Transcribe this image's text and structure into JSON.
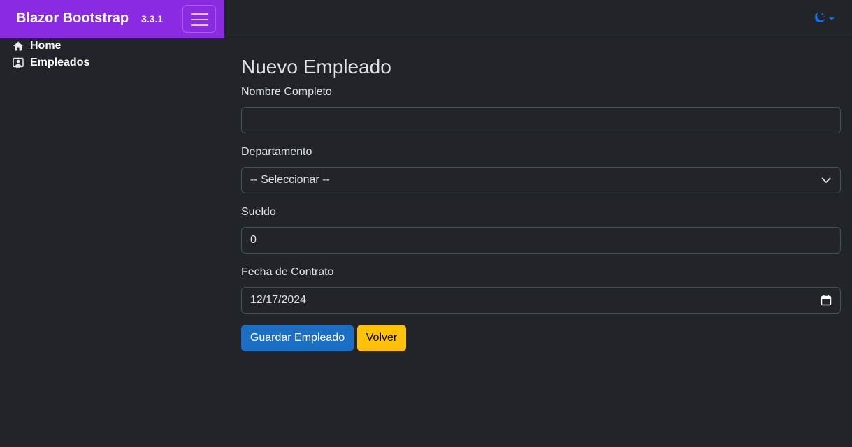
{
  "brand": {
    "name": "Blazor Bootstrap",
    "version": "3.3.1",
    "color": "#8a2be2"
  },
  "header": {
    "menu_toggle_icon": "hamburger-icon",
    "theme_icon": "moon-stars-icon",
    "theme_color": "#0d6efd"
  },
  "sidebar": {
    "items": [
      {
        "label": "Home",
        "icon": "house-icon"
      },
      {
        "label": "Empleados",
        "icon": "person-badge-icon"
      }
    ]
  },
  "form": {
    "title": "Nuevo Empleado",
    "fields": {
      "nombre": {
        "label": "Nombre Completo",
        "value": ""
      },
      "departamento": {
        "label": "Departamento",
        "value": "-- Seleccionar --"
      },
      "sueldo": {
        "label": "Sueldo",
        "value": "0"
      },
      "fecha": {
        "label": "Fecha de Contrato",
        "value": "12/17/2024"
      }
    },
    "buttons": {
      "save": {
        "label": "Guardar Empleado",
        "color": "#1b6ec2"
      },
      "back": {
        "label": "Volver",
        "color": "#ffc107"
      }
    }
  }
}
